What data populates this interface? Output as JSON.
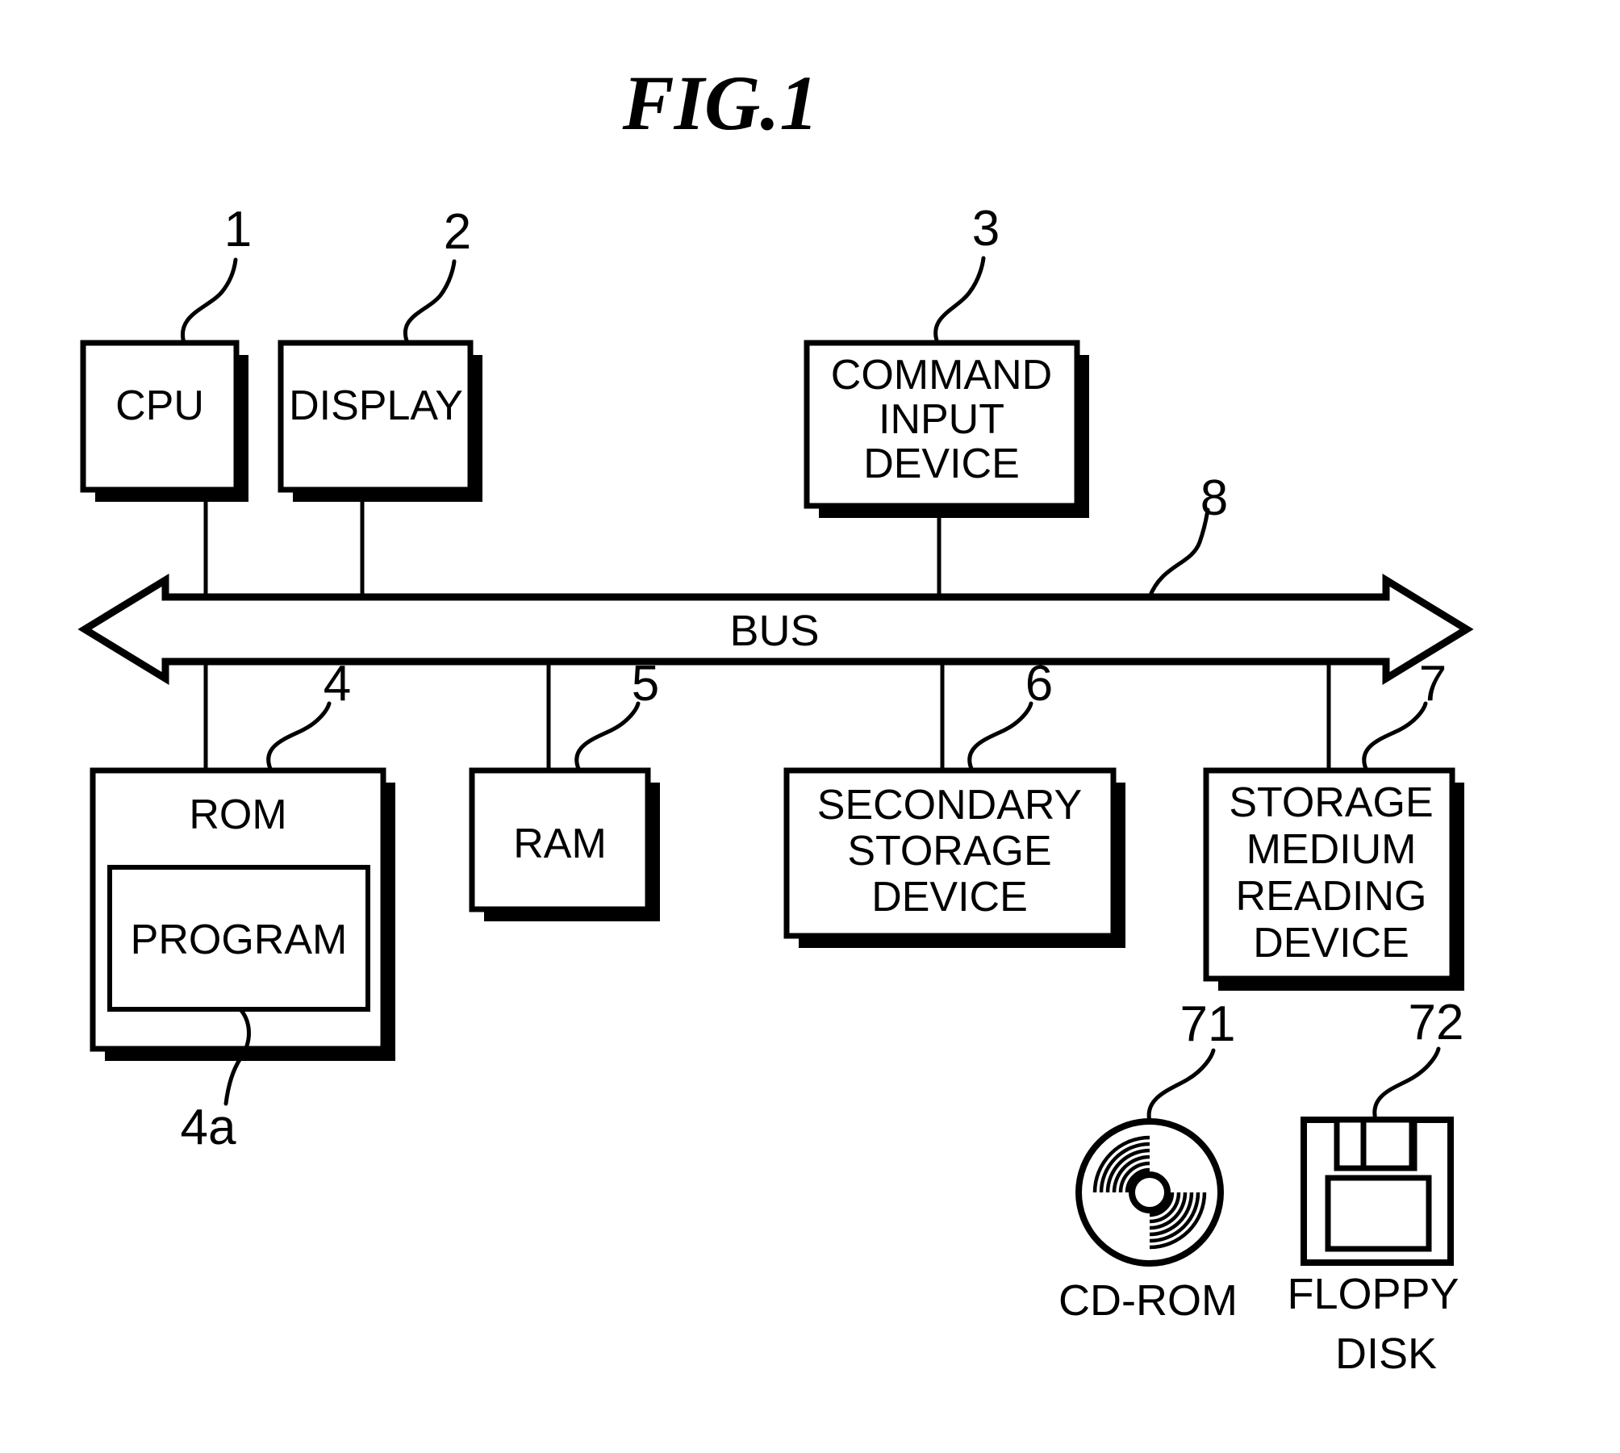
{
  "figure": {
    "title": "FIG.1",
    "bus_label": "BUS"
  },
  "blocks": {
    "cpu": {
      "label": "CPU",
      "numeral": "1"
    },
    "display": {
      "label": "DISPLAY",
      "numeral": "2"
    },
    "command_input_device": {
      "line1": "COMMAND",
      "line2": "INPUT",
      "line3": "DEVICE",
      "numeral": "3"
    },
    "rom": {
      "label": "ROM",
      "numeral": "4"
    },
    "program": {
      "label": "PROGRAM",
      "numeral": "4a"
    },
    "ram": {
      "label": "RAM",
      "numeral": "5"
    },
    "secondary_storage_device": {
      "line1": "SECONDARY",
      "line2": "STORAGE",
      "line3": "DEVICE",
      "numeral": "6"
    },
    "storage_medium_reading_device": {
      "line1": "STORAGE",
      "line2": "MEDIUM",
      "line3": "READING",
      "line4": "DEVICE",
      "numeral": "7"
    },
    "bus": {
      "label": "BUS",
      "numeral": "8"
    }
  },
  "media": {
    "cdrom": {
      "label": "CD-ROM",
      "numeral": "71"
    },
    "floppy": {
      "line1": "FLOPPY",
      "line2": "DISK",
      "numeral": "72"
    }
  },
  "colors": {
    "ink": "#000000",
    "paper": "#ffffff"
  }
}
